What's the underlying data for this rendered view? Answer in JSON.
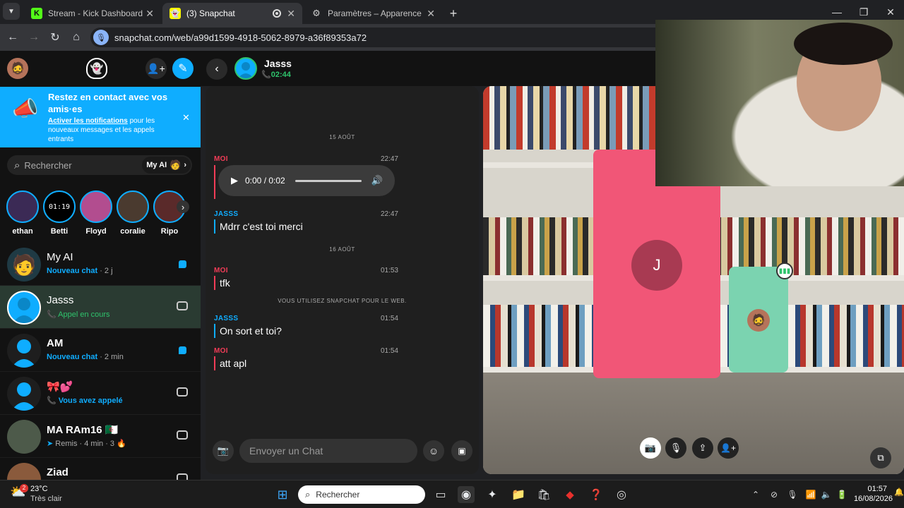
{
  "browser": {
    "tabs": [
      {
        "title": "Stream - Kick Dashboard"
      },
      {
        "title": "(3) Snapchat"
      },
      {
        "title": "Paramètres – Apparence"
      }
    ],
    "url": "snapchat.com/web/a99d1599-4918-5062-8979-a36f89353a72"
  },
  "notification_banner": {
    "title": "Restez en contact avec vos amis·es",
    "link": "Activer les notifications",
    "text": " pour les nouveaux messages et les appels entrants"
  },
  "search": {
    "placeholder": "Rechercher",
    "myai_label": "My AI"
  },
  "stories": [
    {
      "name": "ethan"
    },
    {
      "name": "Betti",
      "clock": "01:19"
    },
    {
      "name": "Floyd"
    },
    {
      "name": "coralie"
    },
    {
      "name": "Ripo"
    }
  ],
  "chats": [
    {
      "name": "My AI",
      "status": "Nouveau chat",
      "time": "· 2 j"
    },
    {
      "name": "Jasss",
      "status": "Appel en cours",
      "time": ""
    },
    {
      "name": "AM",
      "status": "Nouveau chat",
      "time": "· 2 min"
    },
    {
      "name": "🎀💕",
      "status": "Vous avez appelé",
      "time": ""
    },
    {
      "name": "MA RAm16 🇩🇿",
      "status": "Remis",
      "time": "· 4 min · 3 🔥"
    },
    {
      "name": "Ziad",
      "status": "",
      "time": ""
    }
  ],
  "conversation": {
    "contact": "Jasss",
    "call_time": "02:44",
    "day1": "15 AOÛT",
    "day2": "16 AOÛT",
    "system_note": "VOUS UTILISEZ SNAPCHAT POUR LE WEB.",
    "messages": [
      {
        "sender": "MOI",
        "time": "22:47",
        "text": "0:00 / 0:02"
      },
      {
        "sender": "JASSS",
        "time": "22:47",
        "text": "Mdrr c'est toi merci"
      },
      {
        "sender": "MOI",
        "time": "01:53",
        "text": "tfk"
      },
      {
        "sender": "JASSS",
        "time": "01:54",
        "text": "On sort et toi?"
      },
      {
        "sender": "MOI",
        "time": "01:54",
        "text": "att apl"
      }
    ],
    "composer_placeholder": "Envoyer un Chat"
  },
  "call": {
    "participant_initial": "J"
  },
  "taskbar": {
    "weather_temp": "23°C",
    "weather_desc": "Très clair",
    "weather_badge": "2",
    "search_placeholder": "Rechercher",
    "time": "01:57",
    "date": "16/08/2026"
  },
  "colors": {
    "snap_blue": "#0fadff",
    "moi_red": "#f23c57",
    "call_green": "#2fc36c",
    "pink_tile": "#f15677",
    "green_tile": "#7bd3b0"
  }
}
